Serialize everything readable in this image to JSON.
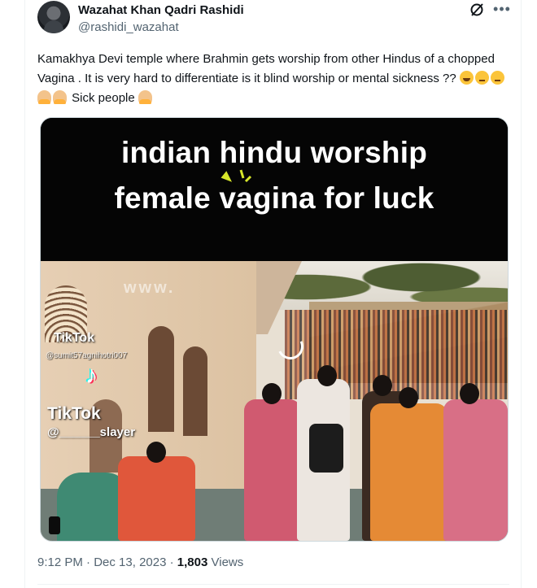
{
  "author": {
    "name": "Wazahat Khan Qadri Rashidi",
    "handle": "@rashidi_wazahat"
  },
  "icons": {
    "grok": "grok-icon",
    "more": "more-options-icon"
  },
  "tweet": {
    "text_part1": "Kamakhya Devi temple where Brahmin gets worship from other Hindus of a chopped Vagina .  It is very hard to differentiate is it blind worship or mental sickness ?? ",
    "text_part2": " Sick people ",
    "emojis": [
      "face-with-tears-of-joy",
      "worried-face",
      "worried-face",
      "person-shrugging",
      "person-shrugging",
      "person-shrugging"
    ]
  },
  "media": {
    "caption_line1": "indian hindu worship",
    "caption_line2": "female vagina for luck",
    "watermark": "www.",
    "tiktok_label_small": "TikTok",
    "tiktok_user_small": "@sumit57agnihotri007",
    "tiktok_brand": "TikTok",
    "tiktok_user": "@______slayer"
  },
  "meta": {
    "time": "9:12 PM",
    "separator1": " · ",
    "date": "Dec 13, 2023",
    "separator2": " · ",
    "views_count": "1,803",
    "views_label": " Views"
  }
}
